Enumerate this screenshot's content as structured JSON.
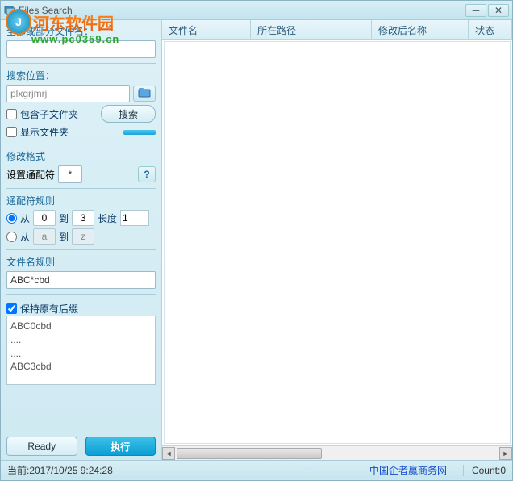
{
  "window": {
    "title": "Files Search"
  },
  "watermark": {
    "brand": "河东软件园",
    "url": "www.pc0359.cn"
  },
  "left": {
    "filename_label": "全部或部分文件名：",
    "filename_value": "",
    "location_label": "搜索位置：",
    "location_value": "plxgrjmrj",
    "include_sub": "包含子文件夹",
    "show_folder": "显示文件夹",
    "search_btn": "搜索",
    "format_label": "修改格式",
    "wildcard_label": "设置通配符",
    "wildcard_value": "*",
    "help": "?",
    "rule_label": "通配符规则",
    "from": "从",
    "to": "到",
    "length": "长度",
    "from1_val": "0",
    "to1_val": "3",
    "len_val": "1",
    "from2_val": "a",
    "to2_val": "z",
    "filename_rule_label": "文件名规则",
    "filename_rule_value": "ABC*cbd",
    "keep_ext": "保持原有后缀",
    "preview1": "ABC0cbd",
    "preview2": "....",
    "preview3": "ABC3cbd",
    "ready_btn": "Ready",
    "exec_btn": "执行"
  },
  "table": {
    "col1": "文件名",
    "col2": "所在路径",
    "col3": "修改后名称",
    "col4": "状态"
  },
  "status": {
    "left": "当前:2017/10/25 9:24:28",
    "center": "中国企者赢商务网",
    "right": "Count:0"
  }
}
